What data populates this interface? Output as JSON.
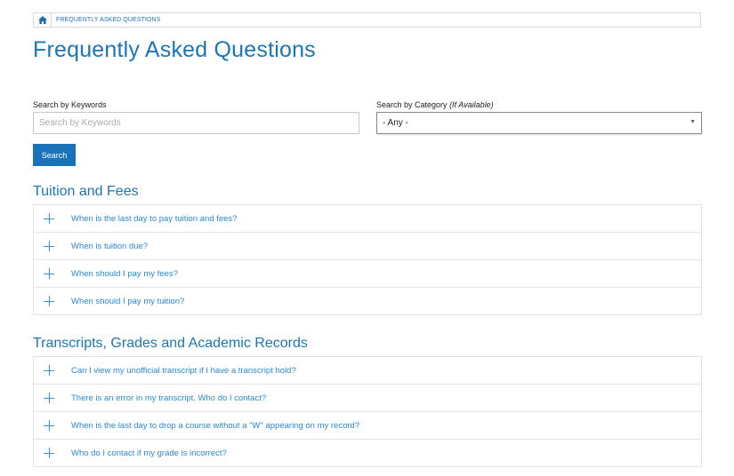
{
  "breadcrumb": {
    "home_icon": "home-icon",
    "current": "FREQUENTLY ASKED QUESTIONS"
  },
  "page_title": "Frequently Asked Questions",
  "search": {
    "keyword_label": "Search by Keywords",
    "keyword_placeholder": "Search by Keywords",
    "keyword_value": "",
    "category_label": "Search by Category",
    "category_label_note": "(If Available)",
    "category_selected": "- Any -",
    "button_label": "Search"
  },
  "sections": [
    {
      "title": "Tuition and Fees",
      "questions": [
        "When is the last day to pay tuition and fees?",
        "When is tuition due?",
        "When should I pay my fees?",
        "When should I pay my tuition?"
      ]
    },
    {
      "title": "Transcripts, Grades and Academic Records",
      "questions": [
        "Can I view my unofficial transcript if I have a transcript hold?",
        "There is an error in my transcript. Who do I contact?",
        "When is the last day to drop a course without a \"W\" appearing on my record?",
        "Who do I contact if my grade is incorrect?"
      ]
    }
  ],
  "colors": {
    "accent": "#1a73b8",
    "link": "#2a8ad6",
    "border": "#e3e3e3"
  }
}
